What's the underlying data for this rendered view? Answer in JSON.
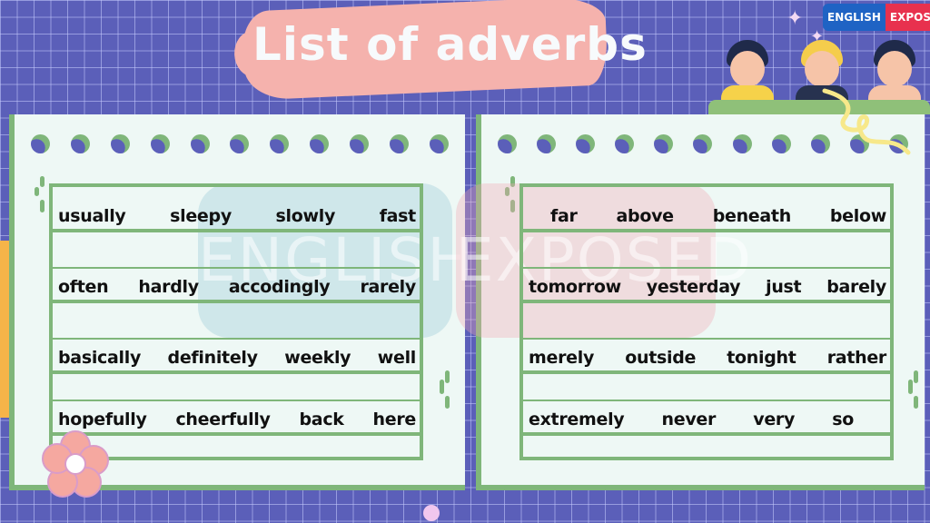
{
  "title": "List of adverbs",
  "logo": {
    "part1": "ENGLISH",
    "part2": "EXPOSED"
  },
  "watermark": {
    "part1": "ENGLISH",
    "part2": "EXPOSED"
  },
  "colors": {
    "background": "#5b5fb9",
    "panel": "#eef8f5",
    "line_green": "#7fb67a",
    "brush_pink": "#f5b2ad",
    "logo_blue": "#1f63c4",
    "logo_red": "#e8314e"
  },
  "icons": [
    "children-illustration",
    "sparkle-icon",
    "flower-icon",
    "squiggle-ribbon"
  ],
  "left_card": {
    "rows": [
      [
        "usually",
        "sleepy",
        "slowly",
        "fast"
      ],
      [
        "often",
        "hardly",
        "accodingly",
        "rarely"
      ],
      [
        "basically",
        "definitely",
        "weekly",
        "well"
      ],
      [
        "hopefully",
        "cheerfully",
        "back",
        "here"
      ]
    ]
  },
  "right_card": {
    "rows": [
      [
        "far",
        "above",
        "beneath",
        "below"
      ],
      [
        "tomorrow",
        "yesterday",
        "just",
        "barely"
      ],
      [
        "merely",
        "outside",
        "tonight",
        "rather"
      ],
      [
        "extremely",
        "never",
        "very",
        "so"
      ]
    ]
  }
}
